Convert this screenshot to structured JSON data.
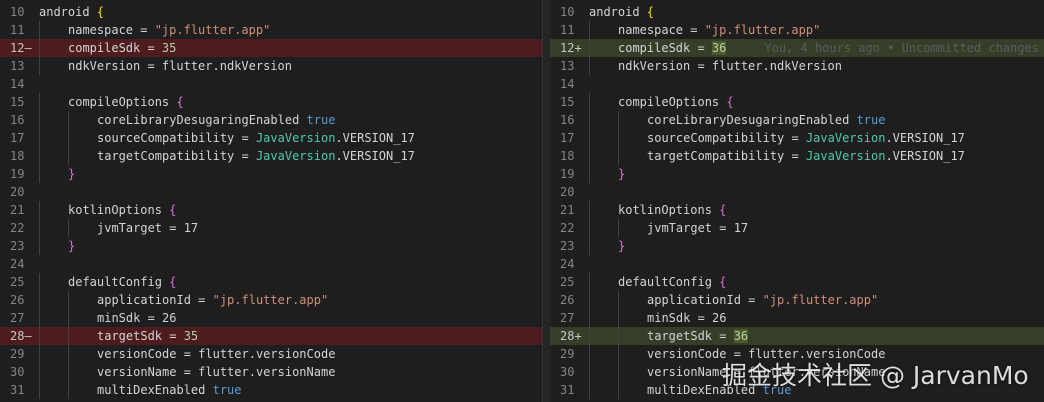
{
  "left": {
    "lines": [
      {
        "n": "10",
        "t": [
          [
            "",
            "android "
          ],
          [
            "b1",
            "{"
          ]
        ]
      },
      {
        "n": "11",
        "i": 1,
        "t": [
          [
            "",
            "namespace = "
          ],
          [
            "str",
            "\"jp.flutter.app\""
          ]
        ]
      },
      {
        "n": "12—",
        "i": 1,
        "d": "del",
        "t": [
          [
            "",
            "compileSdk = "
          ],
          [
            "num",
            "35"
          ]
        ]
      },
      {
        "n": "13",
        "i": 1,
        "t": [
          [
            "",
            "ndkVersion = flutter.ndkVersion"
          ]
        ]
      },
      {
        "n": "14",
        "t": []
      },
      {
        "n": "15",
        "i": 1,
        "t": [
          [
            "",
            "compileOptions "
          ],
          [
            "b2",
            "{"
          ]
        ]
      },
      {
        "n": "16",
        "i": 2,
        "t": [
          [
            "",
            "coreLibraryDesugaringEnabled "
          ],
          [
            "kw",
            "true"
          ]
        ]
      },
      {
        "n": "17",
        "i": 2,
        "t": [
          [
            "",
            "sourceCompatibility = "
          ],
          [
            "type",
            "JavaVersion"
          ],
          [
            "",
            ".VERSION_17"
          ]
        ]
      },
      {
        "n": "18",
        "i": 2,
        "t": [
          [
            "",
            "targetCompatibility = "
          ],
          [
            "type",
            "JavaVersion"
          ],
          [
            "",
            ".VERSION_17"
          ]
        ]
      },
      {
        "n": "19",
        "i": 1,
        "t": [
          [
            "b2",
            "}"
          ]
        ]
      },
      {
        "n": "20",
        "t": []
      },
      {
        "n": "21",
        "i": 1,
        "t": [
          [
            "",
            "kotlinOptions "
          ],
          [
            "b2",
            "{"
          ]
        ]
      },
      {
        "n": "22",
        "i": 2,
        "t": [
          [
            "",
            "jvmTarget = 17"
          ]
        ]
      },
      {
        "n": "23",
        "i": 1,
        "t": [
          [
            "b2",
            "}"
          ]
        ]
      },
      {
        "n": "24",
        "t": []
      },
      {
        "n": "25",
        "i": 1,
        "t": [
          [
            "",
            "defaultConfig "
          ],
          [
            "b2",
            "{"
          ]
        ]
      },
      {
        "n": "26",
        "i": 2,
        "t": [
          [
            "",
            "applicationId = "
          ],
          [
            "str",
            "\"jp.flutter.app\""
          ]
        ]
      },
      {
        "n": "27",
        "i": 2,
        "t": [
          [
            "",
            "minSdk = 26"
          ]
        ]
      },
      {
        "n": "28—",
        "i": 2,
        "d": "del",
        "t": [
          [
            "",
            "targetSdk = "
          ],
          [
            "num",
            "35"
          ]
        ]
      },
      {
        "n": "29",
        "i": 2,
        "t": [
          [
            "",
            "versionCode = flutter.versionCode"
          ]
        ]
      },
      {
        "n": "30",
        "i": 2,
        "t": [
          [
            "",
            "versionName = flutter.versionName"
          ]
        ]
      },
      {
        "n": "31",
        "i": 2,
        "t": [
          [
            "",
            "multiDexEnabled "
          ],
          [
            "kw",
            "true"
          ]
        ]
      }
    ]
  },
  "right": {
    "lines": [
      {
        "n": "10",
        "t": [
          [
            "",
            "android "
          ],
          [
            "b1",
            "{"
          ]
        ]
      },
      {
        "n": "11",
        "i": 1,
        "t": [
          [
            "",
            "namespace = "
          ],
          [
            "str",
            "\"jp.flutter.app\""
          ]
        ]
      },
      {
        "n": "12+",
        "i": 1,
        "d": "add",
        "t": [
          [
            "",
            "compileSdk = "
          ],
          [
            "num hl",
            "36"
          ],
          [
            "blame",
            "You, 4 hours ago • Uncommitted changes"
          ]
        ]
      },
      {
        "n": "13",
        "i": 1,
        "t": [
          [
            "",
            "ndkVersion = flutter.ndkVersion"
          ]
        ]
      },
      {
        "n": "14",
        "t": []
      },
      {
        "n": "15",
        "i": 1,
        "t": [
          [
            "",
            "compileOptions "
          ],
          [
            "b2",
            "{"
          ]
        ]
      },
      {
        "n": "16",
        "i": 2,
        "t": [
          [
            "",
            "coreLibraryDesugaringEnabled "
          ],
          [
            "kw",
            "true"
          ]
        ]
      },
      {
        "n": "17",
        "i": 2,
        "t": [
          [
            "",
            "sourceCompatibility = "
          ],
          [
            "type",
            "JavaVersion"
          ],
          [
            "",
            ".VERSION_17"
          ]
        ]
      },
      {
        "n": "18",
        "i": 2,
        "t": [
          [
            "",
            "targetCompatibility = "
          ],
          [
            "type",
            "JavaVersion"
          ],
          [
            "",
            ".VERSION_17"
          ]
        ]
      },
      {
        "n": "19",
        "i": 1,
        "t": [
          [
            "b2",
            "}"
          ]
        ]
      },
      {
        "n": "20",
        "t": []
      },
      {
        "n": "21",
        "i": 1,
        "t": [
          [
            "",
            "kotlinOptions "
          ],
          [
            "b2",
            "{"
          ]
        ]
      },
      {
        "n": "22",
        "i": 2,
        "t": [
          [
            "",
            "jvmTarget = 17"
          ]
        ]
      },
      {
        "n": "23",
        "i": 1,
        "t": [
          [
            "b2",
            "}"
          ]
        ]
      },
      {
        "n": "24",
        "t": []
      },
      {
        "n": "25",
        "i": 1,
        "t": [
          [
            "",
            "defaultConfig "
          ],
          [
            "b2",
            "{"
          ]
        ]
      },
      {
        "n": "26",
        "i": 2,
        "t": [
          [
            "",
            "applicationId = "
          ],
          [
            "str",
            "\"jp.flutter.app\""
          ]
        ]
      },
      {
        "n": "27",
        "i": 2,
        "t": [
          [
            "",
            "minSdk = 26"
          ]
        ]
      },
      {
        "n": "28+",
        "i": 2,
        "d": "add",
        "t": [
          [
            "",
            "targetSdk = "
          ],
          [
            "num hl",
            "36"
          ]
        ]
      },
      {
        "n": "29",
        "i": 2,
        "t": [
          [
            "",
            "versionCode = flutter.versionCode"
          ]
        ]
      },
      {
        "n": "30",
        "i": 2,
        "t": [
          [
            "",
            "versionName = flutter.versionName"
          ]
        ]
      },
      {
        "n": "31",
        "i": 2,
        "t": [
          [
            "",
            "multiDexEnabled "
          ],
          [
            "kw",
            "true"
          ]
        ]
      }
    ]
  },
  "watermark": "掘金技术社区 @ JarvanMo",
  "colors": {
    "background": "#1e1e1e",
    "deleted": "#4e1c1f",
    "added": "#363d28"
  }
}
